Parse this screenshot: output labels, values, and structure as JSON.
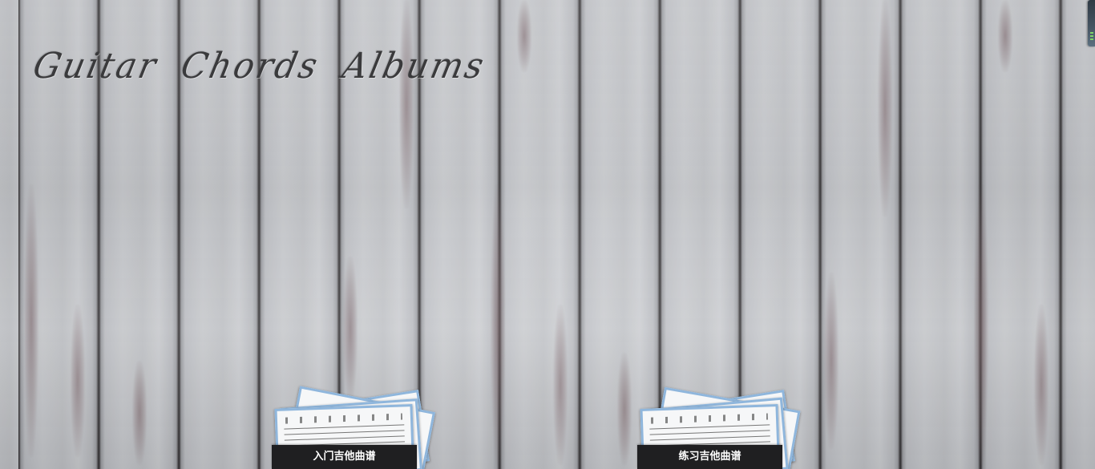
{
  "header": {
    "title": "Guitar Chords Albums"
  },
  "albums": [
    {
      "label": "入门吉他曲谱"
    },
    {
      "label": "练习吉他曲谱"
    }
  ],
  "widgets": {
    "corner_icon": "toolbar-handle-icon"
  },
  "colors": {
    "caption_background": "#1f1f21",
    "caption_text": "#ffffff",
    "sheet_border": "#8fb6dc",
    "title_text": "#3a3a3c"
  }
}
